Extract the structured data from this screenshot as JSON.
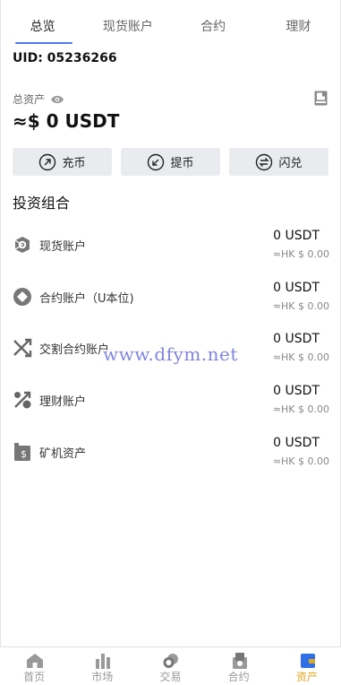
{
  "tabs": [
    {
      "label": "总览",
      "active": true
    },
    {
      "label": "现货账户",
      "active": false
    },
    {
      "label": "合约",
      "active": false
    },
    {
      "label": "理财",
      "active": false
    }
  ],
  "uid": "UID: 05236266",
  "total_assets": {
    "label": "总资产",
    "value": "≈$ 0 USDT"
  },
  "actions": [
    {
      "label": "充币",
      "icon": "arrow-up-right-circle-icon"
    },
    {
      "label": "提币",
      "icon": "arrow-down-left-circle-icon"
    },
    {
      "label": "闪兑",
      "icon": "swap-circle-icon"
    }
  ],
  "portfolio": {
    "title": "投资组合",
    "accounts": [
      {
        "name": "现货账户",
        "amount": "0 USDT",
        "hk": "≈HK $ 0.00",
        "icon": "spot-icon"
      },
      {
        "name": "合约账户（U本位)",
        "amount": "0 USDT",
        "hk": "≈HK $ 0.00",
        "icon": "contract-icon"
      },
      {
        "name": "交割合约账户",
        "amount": "0 USDT",
        "hk": "≈HK $ 0.00",
        "icon": "delivery-icon"
      },
      {
        "name": "理财账户",
        "amount": "0 USDT",
        "hk": "≈HK $ 0.00",
        "icon": "finance-icon"
      },
      {
        "name": "矿机资产",
        "amount": "0 USDT",
        "hk": "≈HK $ 0.00",
        "icon": "mining-icon"
      }
    ]
  },
  "watermark": "www.dfym.net",
  "bottom_nav": [
    {
      "label": "首页",
      "icon": "home-icon",
      "active": false
    },
    {
      "label": "市场",
      "icon": "market-icon",
      "active": false
    },
    {
      "label": "交易",
      "icon": "trade-icon",
      "active": false
    },
    {
      "label": "合约",
      "icon": "contract-nav-icon",
      "active": false
    },
    {
      "label": "资产",
      "icon": "wallet-icon",
      "active": true
    }
  ],
  "colors": {
    "accent_tab": "#4a7df0",
    "active_nav": "#e0a820",
    "watermark": "#6a70d8"
  }
}
